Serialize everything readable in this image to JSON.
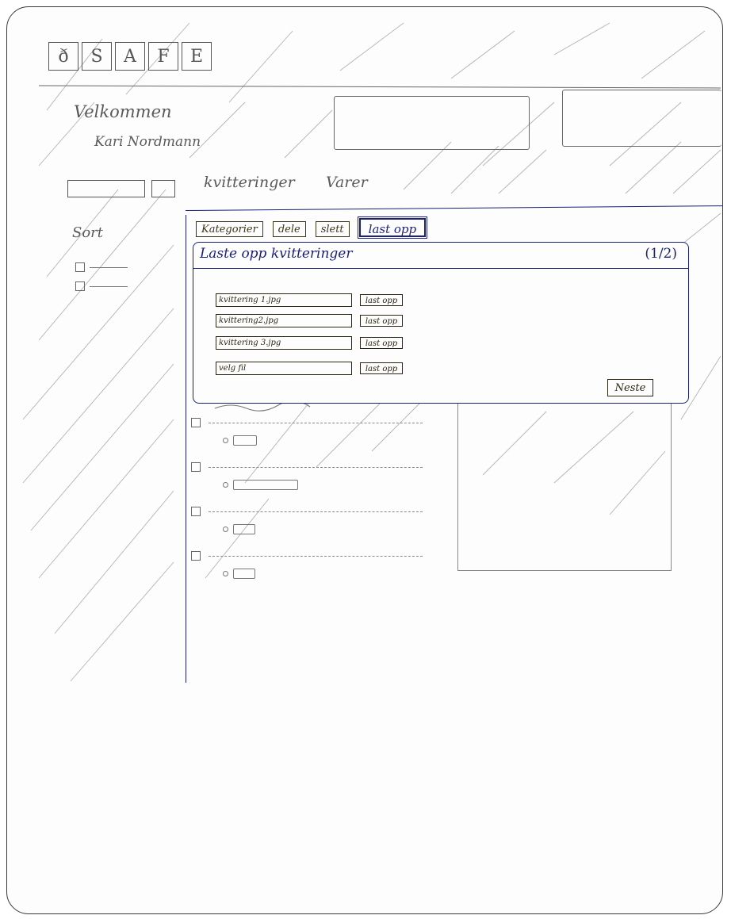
{
  "logo": {
    "letters": [
      "ð",
      "S",
      "A",
      "F",
      "E"
    ]
  },
  "header": {
    "welcome": "Velkommen",
    "user_name": "Kari Nordmann"
  },
  "nav": {
    "receipts_label": "kvitteringer",
    "products_label": "Varer"
  },
  "sidebar": {
    "title": "Sort"
  },
  "tabs": [
    {
      "label": "Kategorier",
      "active": false
    },
    {
      "label": "dele",
      "active": false
    },
    {
      "label": "slett",
      "active": false
    },
    {
      "label": "last opp",
      "active": true
    }
  ],
  "modal": {
    "title": "Laste opp kvitteringer",
    "step": "(1/2)",
    "files": [
      {
        "value": "kvittering 1.jpg",
        "button": "last opp"
      },
      {
        "value": "kvittering2.jpg",
        "button": "last opp"
      },
      {
        "value": "kvittering 3.jpg",
        "button": "last opp"
      },
      {
        "value": "velg fil",
        "button": "last opp"
      }
    ],
    "next_label": "Neste"
  },
  "colors": {
    "panel_ink": "#1a1f7a",
    "pencil": "#5a5a5a",
    "dark_ink": "#2a2410"
  }
}
